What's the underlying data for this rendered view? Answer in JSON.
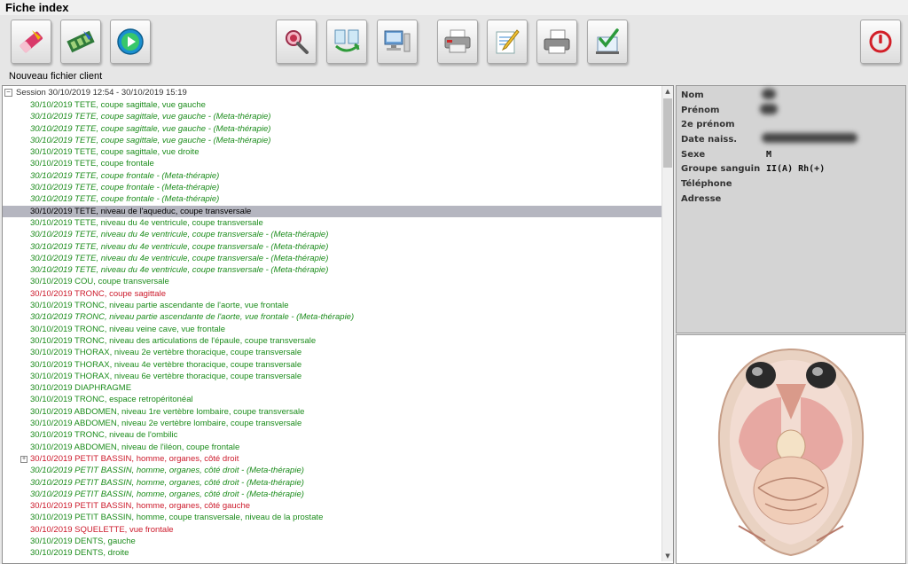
{
  "window": {
    "title": "Fiche index"
  },
  "toolbar": {
    "buttons": [
      {
        "name": "eraser-button",
        "icon": "eraser-icon"
      },
      {
        "name": "film-button",
        "icon": "film-icon"
      },
      {
        "name": "play-button",
        "icon": "play-icon"
      },
      {
        "name": "inspect-button",
        "icon": "magnifier-icon"
      },
      {
        "name": "transfer-button",
        "icon": "transfer-icon"
      },
      {
        "name": "computer-button",
        "icon": "computer-icon"
      },
      {
        "name": "print-button",
        "icon": "printer-icon"
      },
      {
        "name": "edit-button",
        "icon": "edit-icon"
      },
      {
        "name": "fax-button",
        "icon": "fax-icon"
      },
      {
        "name": "validate-button",
        "icon": "checkmark-icon"
      },
      {
        "name": "power-button",
        "icon": "power-icon"
      }
    ],
    "label": "Nouveau fichier client"
  },
  "colors": {
    "green": "#1c8c1c",
    "red": "#cc1a2b",
    "dark": "#202020"
  },
  "session": {
    "label": "Session 30/10/2019 12:54 - 30/10/2019 15:19",
    "items": [
      {
        "text": "30/10/2019  TETE, coupe sagittale, vue gauche",
        "color": "green",
        "italic": false
      },
      {
        "text": "30/10/2019  TETE, coupe sagittale, vue gauche - (Meta-thérapie)",
        "color": "green",
        "italic": true
      },
      {
        "text": "30/10/2019  TETE, coupe sagittale, vue gauche - (Meta-thérapie)",
        "color": "green",
        "italic": true
      },
      {
        "text": "30/10/2019  TETE, coupe sagittale, vue gauche - (Meta-thérapie)",
        "color": "green",
        "italic": true
      },
      {
        "text": "30/10/2019  TETE, coupe sagittale, vue droite",
        "color": "green",
        "italic": false
      },
      {
        "text": "30/10/2019  TETE, coupe frontale",
        "color": "green",
        "italic": false
      },
      {
        "text": "30/10/2019  TETE, coupe frontale - (Meta-thérapie)",
        "color": "green",
        "italic": true
      },
      {
        "text": "30/10/2019  TETE, coupe frontale - (Meta-thérapie)",
        "color": "green",
        "italic": true
      },
      {
        "text": "30/10/2019  TETE, coupe frontale - (Meta-thérapie)",
        "color": "green",
        "italic": true
      },
      {
        "text": "30/10/2019  TETE, niveau de l'aqueduc, coupe transversale",
        "color": "dark",
        "italic": false,
        "selected": true
      },
      {
        "text": "30/10/2019  TETE, niveau du 4e ventricule, coupe transversale",
        "color": "green",
        "italic": false
      },
      {
        "text": "30/10/2019  TETE, niveau du 4e ventricule, coupe transversale - (Meta-thérapie)",
        "color": "green",
        "italic": true
      },
      {
        "text": "30/10/2019  TETE, niveau du 4e ventricule, coupe transversale - (Meta-thérapie)",
        "color": "green",
        "italic": true
      },
      {
        "text": "30/10/2019  TETE, niveau du 4e ventricule, coupe transversale - (Meta-thérapie)",
        "color": "green",
        "italic": true
      },
      {
        "text": "30/10/2019  TETE, niveau du 4e ventricule, coupe transversale - (Meta-thérapie)",
        "color": "green",
        "italic": true
      },
      {
        "text": "30/10/2019  COU, coupe transversale",
        "color": "green",
        "italic": false
      },
      {
        "text": "30/10/2019  TRONC, coupe sagittale",
        "color": "red",
        "italic": false
      },
      {
        "text": "30/10/2019  TRONC, niveau partie ascendante de l'aorte, vue frontale",
        "color": "green",
        "italic": false
      },
      {
        "text": "30/10/2019  TRONC, niveau partie ascendante de l'aorte, vue frontale - (Meta-thérapie)",
        "color": "green",
        "italic": true
      },
      {
        "text": "30/10/2019  TRONC, niveau veine cave, vue frontale",
        "color": "green",
        "italic": false
      },
      {
        "text": "30/10/2019  TRONC, niveau des articulations de l'épaule, coupe transversale",
        "color": "green",
        "italic": false
      },
      {
        "text": "30/10/2019  THORAX, niveau 2e vertèbre thoracique, coupe transversale",
        "color": "green",
        "italic": false
      },
      {
        "text": "30/10/2019  THORAX, niveau 4e vertèbre thoracique, coupe transversale",
        "color": "green",
        "italic": false
      },
      {
        "text": "30/10/2019  THORAX, niveau 6e vertèbre thoracique, coupe transversale",
        "color": "green",
        "italic": false
      },
      {
        "text": "30/10/2019  DIAPHRAGME",
        "color": "green",
        "italic": false
      },
      {
        "text": "30/10/2019  TRONC, espace retropéritonéal",
        "color": "green",
        "italic": false
      },
      {
        "text": "30/10/2019  ABDOMEN, niveau 1re vertèbre lombaire, coupe transversale",
        "color": "green",
        "italic": false
      },
      {
        "text": "30/10/2019  ABDOMEN, niveau 2e vertèbre lombaire, coupe transversale",
        "color": "green",
        "italic": false
      },
      {
        "text": "30/10/2019  TRONC, niveau de l'ombilic",
        "color": "green",
        "italic": false
      },
      {
        "text": "30/10/2019  ABDOMEN, niveau de l'iléon, coupe frontale",
        "color": "green",
        "italic": false
      },
      {
        "text": "30/10/2019  PETIT BASSIN, homme, organes, côté droit",
        "color": "red",
        "italic": false,
        "expandable": true
      },
      {
        "text": "30/10/2019  PETIT BASSIN, homme, organes, côté droit - (Meta-thérapie)",
        "color": "green",
        "italic": true
      },
      {
        "text": "30/10/2019  PETIT BASSIN, homme, organes, côté droit - (Meta-thérapie)",
        "color": "green",
        "italic": true
      },
      {
        "text": "30/10/2019  PETIT BASSIN, homme, organes, côté droit - (Meta-thérapie)",
        "color": "green",
        "italic": true
      },
      {
        "text": "30/10/2019  PETIT BASSIN, homme, organes, côté gauche",
        "color": "red",
        "italic": false
      },
      {
        "text": "30/10/2019  PETIT BASSIN, homme, coupe transversale, niveau de la prostate",
        "color": "green",
        "italic": false
      },
      {
        "text": "30/10/2019  SQUELETTE, vue frontale",
        "color": "red",
        "italic": false
      },
      {
        "text": "30/10/2019  DENTS, gauche",
        "color": "green",
        "italic": false
      },
      {
        "text": "30/10/2019  DENTS, droite",
        "color": "green",
        "italic": false
      }
    ]
  },
  "patient": {
    "nom_label": "Nom",
    "prenom_label": "Prénom",
    "second_prenom_label": "2e prénom",
    "date_naiss_label": "Date naiss.",
    "sexe_label": "Sexe",
    "sexe_value": "M",
    "groupe_label": "Groupe sanguin",
    "groupe_value": "II(A) Rh(+)",
    "telephone_label": "Téléphone",
    "adresse_label": "Adresse"
  }
}
